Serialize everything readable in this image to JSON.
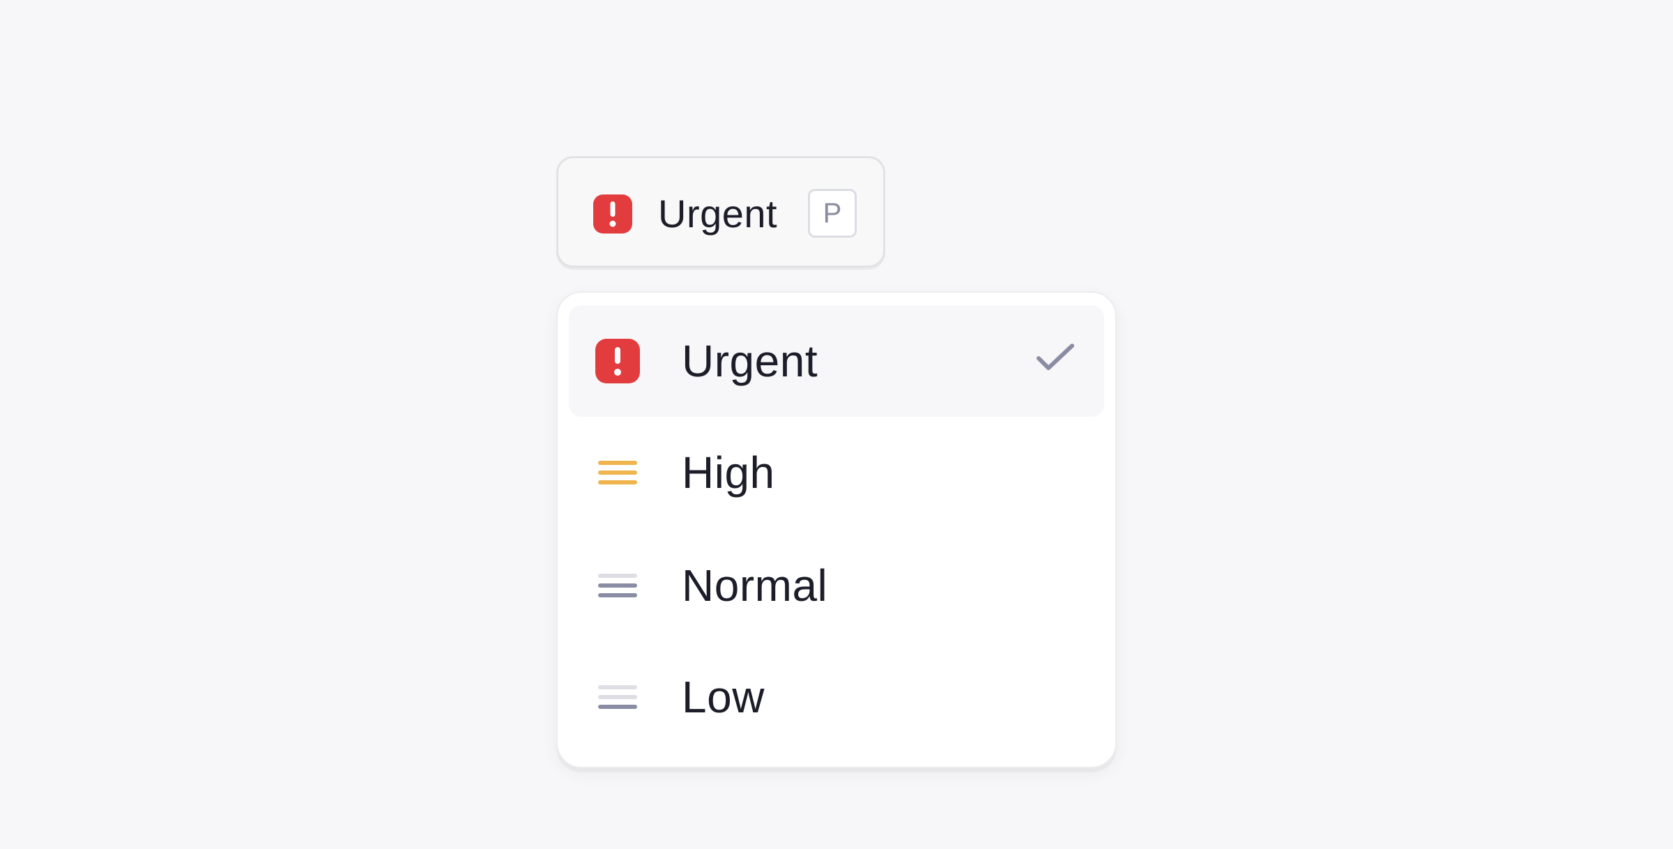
{
  "trigger": {
    "label": "Urgent",
    "shortcut": "P",
    "icon": "urgent-icon"
  },
  "menu": {
    "items": [
      {
        "label": "Urgent",
        "icon": "urgent-icon",
        "selected": true
      },
      {
        "label": "High",
        "icon": "high-priority-icon",
        "selected": false
      },
      {
        "label": "Normal",
        "icon": "normal-priority-icon",
        "selected": false
      },
      {
        "label": "Low",
        "icon": "low-priority-icon",
        "selected": false
      }
    ]
  },
  "colors": {
    "urgent": "#e23c3e",
    "high": "#f0b44c",
    "normal_active": "#8a8ca4",
    "inactive": "#dedee4",
    "text": "#1c1d29",
    "background": "#f7f7f9"
  }
}
